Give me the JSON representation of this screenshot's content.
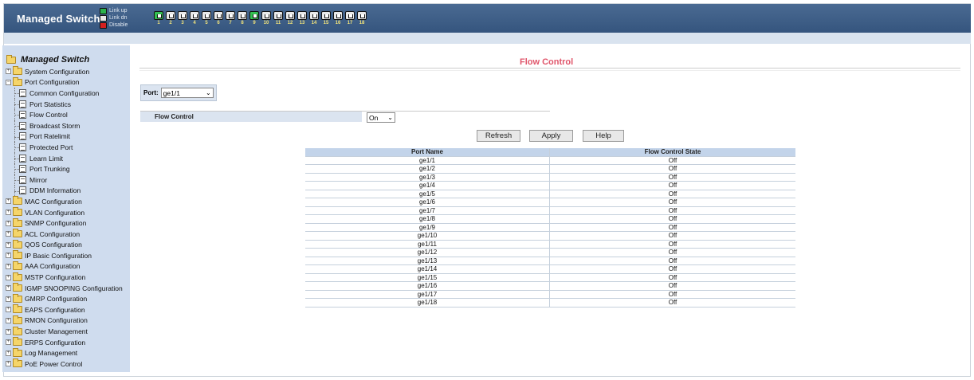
{
  "header": {
    "brand": "Managed Switch",
    "legend": [
      {
        "label": "Link up",
        "state": "up",
        "color": "#2bb24c"
      },
      {
        "label": "Link dn",
        "state": "dn",
        "color": "#e6e6e6"
      },
      {
        "label": "Disable",
        "state": "dis",
        "color": "#d42020"
      }
    ],
    "ports": [
      {
        "num": "1",
        "state": "up"
      },
      {
        "num": "2",
        "state": "dn"
      },
      {
        "num": "3",
        "state": "dn"
      },
      {
        "num": "4",
        "state": "dn"
      },
      {
        "num": "5",
        "state": "dn"
      },
      {
        "num": "6",
        "state": "dn"
      },
      {
        "num": "7",
        "state": "dn"
      },
      {
        "num": "8",
        "state": "dn"
      },
      {
        "num": "9",
        "state": "up"
      },
      {
        "num": "10",
        "state": "dn"
      },
      {
        "num": "11",
        "state": "dn"
      },
      {
        "num": "12",
        "state": "dn"
      },
      {
        "num": "13",
        "state": "dn"
      },
      {
        "num": "14",
        "state": "dn"
      },
      {
        "num": "15",
        "state": "dn"
      },
      {
        "num": "16",
        "state": "dn"
      },
      {
        "num": "17",
        "state": "dn"
      },
      {
        "num": "18",
        "state": "dn"
      }
    ]
  },
  "sidebar": {
    "root": "Managed Switch",
    "items": [
      {
        "label": "System Configuration",
        "type": "folder",
        "expanded": false
      },
      {
        "label": "Port Configuration",
        "type": "folder",
        "expanded": true
      },
      {
        "label": "Common Configuration",
        "type": "page",
        "child": true
      },
      {
        "label": "Port Statistics",
        "type": "page",
        "child": true
      },
      {
        "label": "Flow Control",
        "type": "page",
        "child": true
      },
      {
        "label": "Broadcast Storm",
        "type": "page",
        "child": true
      },
      {
        "label": "Port Ratelimit",
        "type": "page",
        "child": true
      },
      {
        "label": "Protected Port",
        "type": "page",
        "child": true
      },
      {
        "label": "Learn Limit",
        "type": "page",
        "child": true
      },
      {
        "label": "Port Trunking",
        "type": "page",
        "child": true
      },
      {
        "label": "Mirror",
        "type": "page",
        "child": true
      },
      {
        "label": "DDM Information",
        "type": "page",
        "child": true
      },
      {
        "label": "MAC Configuration",
        "type": "folder",
        "expanded": false
      },
      {
        "label": "VLAN Configuration",
        "type": "folder",
        "expanded": false
      },
      {
        "label": "SNMP Configuration",
        "type": "folder",
        "expanded": false
      },
      {
        "label": "ACL Configuration",
        "type": "folder",
        "expanded": false
      },
      {
        "label": "QOS Configuration",
        "type": "folder",
        "expanded": false
      },
      {
        "label": "IP Basic Configuration",
        "type": "folder",
        "expanded": false
      },
      {
        "label": "AAA Configuration",
        "type": "folder",
        "expanded": false
      },
      {
        "label": "MSTP Configuration",
        "type": "folder",
        "expanded": false
      },
      {
        "label": "IGMP SNOOPING Configuration",
        "type": "folder",
        "expanded": false
      },
      {
        "label": "GMRP Configuration",
        "type": "folder",
        "expanded": false
      },
      {
        "label": "EAPS Configuration",
        "type": "folder",
        "expanded": false
      },
      {
        "label": "RMON Configuration",
        "type": "folder",
        "expanded": false
      },
      {
        "label": "Cluster Management",
        "type": "folder",
        "expanded": false
      },
      {
        "label": "ERPS Configuration",
        "type": "folder",
        "expanded": false
      },
      {
        "label": "Log Management",
        "type": "folder",
        "expanded": false
      },
      {
        "label": "PoE Power Control",
        "type": "folder",
        "expanded": false
      }
    ]
  },
  "main": {
    "title": "Flow Control",
    "port_label": "Port:",
    "port_value": "ge1/1",
    "flow_label": "Flow Control",
    "flow_value": "On",
    "buttons": {
      "refresh": "Refresh",
      "apply": "Apply",
      "help": "Help"
    },
    "table": {
      "headers": [
        "Port Name",
        "Flow Control State"
      ],
      "rows": [
        [
          "ge1/1",
          "Off"
        ],
        [
          "ge1/2",
          "Off"
        ],
        [
          "ge1/3",
          "Off"
        ],
        [
          "ge1/4",
          "Off"
        ],
        [
          "ge1/5",
          "Off"
        ],
        [
          "ge1/6",
          "Off"
        ],
        [
          "ge1/7",
          "Off"
        ],
        [
          "ge1/8",
          "Off"
        ],
        [
          "ge1/9",
          "Off"
        ],
        [
          "ge1/10",
          "Off"
        ],
        [
          "ge1/11",
          "Off"
        ],
        [
          "ge1/12",
          "Off"
        ],
        [
          "ge1/13",
          "Off"
        ],
        [
          "ge1/14",
          "Off"
        ],
        [
          "ge1/15",
          "Off"
        ],
        [
          "ge1/16",
          "Off"
        ],
        [
          "ge1/17",
          "Off"
        ],
        [
          "ge1/18",
          "Off"
        ]
      ]
    }
  }
}
